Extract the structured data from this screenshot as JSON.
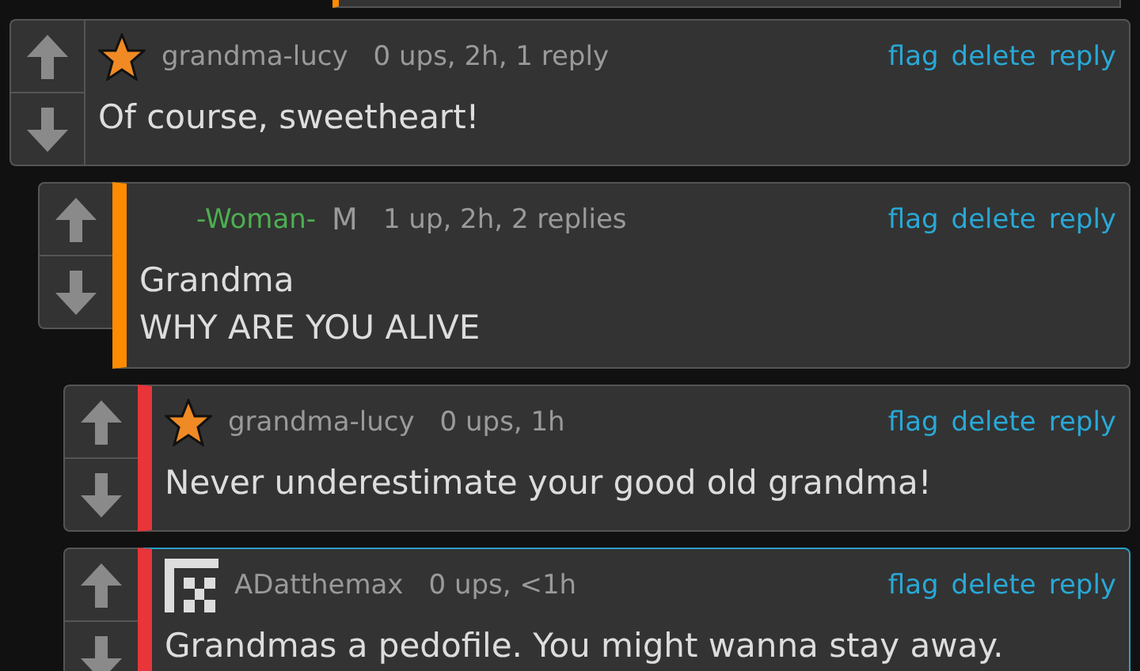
{
  "comments": [
    {
      "author": {
        "name": "grandma-lucy",
        "color": "#9a9a9a"
      },
      "avatar": {
        "kind": "star"
      },
      "meta": "0 ups, 2h, 1 reply",
      "actions": [
        "flag",
        "delete",
        "reply"
      ],
      "lines": [
        "Of course, sweetheart!"
      ],
      "highlighted": false,
      "children": [
        {
          "author": {
            "name": "-Woman-",
            "color": "#4caf50"
          },
          "avatar": {
            "kind": "blank"
          },
          "tag": "M",
          "color": "#ff8c00",
          "meta": "1 up, 2h, 2 replies",
          "actions": [
            "flag",
            "delete",
            "reply"
          ],
          "lines": [
            "Grandma",
            "WHY ARE YOU ALIVE"
          ],
          "highlighted": false,
          "children": [
            {
              "author": {
                "name": "grandma-lucy",
                "color": "#9a9a9a"
              },
              "avatar": {
                "kind": "star"
              },
              "color": "#e8353a",
              "meta": "0 ups, 1h",
              "actions": [
                "flag",
                "delete",
                "reply"
              ],
              "lines": [
                "Never underestimate your good old grandma!"
              ],
              "highlighted": false
            },
            {
              "author": {
                "name": "ADatthemax",
                "color": "#9a9a9a"
              },
              "avatar": {
                "kind": "pixel"
              },
              "color": "#e8353a",
              "meta": "0 ups, <1h",
              "actions": [
                "flag",
                "delete",
                "reply"
              ],
              "lines": [
                "Grandmas a pedofile. You might wanna stay away."
              ],
              "highlighted": true
            }
          ]
        }
      ]
    }
  ]
}
